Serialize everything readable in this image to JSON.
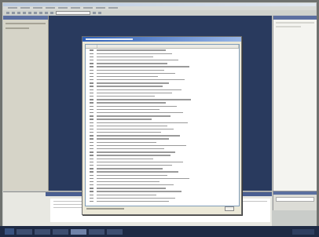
{
  "screen": {
    "description_free": true
  },
  "dialog": {
    "rows": [
      {
        "w": 88
      },
      {
        "w": 96
      },
      {
        "w": 72
      },
      {
        "w": 104
      },
      {
        "w": 90
      },
      {
        "w": 118
      },
      {
        "w": 86
      },
      {
        "w": 100
      },
      {
        "w": 78
      },
      {
        "w": 112
      },
      {
        "w": 92
      },
      {
        "w": 84
      },
      {
        "w": 108
      },
      {
        "w": 96
      },
      {
        "w": 74
      },
      {
        "w": 120
      },
      {
        "w": 88
      },
      {
        "w": 102
      },
      {
        "w": 80
      },
      {
        "w": 110
      },
      {
        "w": 94
      },
      {
        "w": 70
      },
      {
        "w": 116
      },
      {
        "w": 90
      },
      {
        "w": 98
      },
      {
        "w": 82
      },
      {
        "w": 106
      },
      {
        "w": 92
      },
      {
        "w": 76
      },
      {
        "w": 114
      },
      {
        "w": 86
      },
      {
        "w": 100
      },
      {
        "w": 94
      },
      {
        "w": 72
      },
      {
        "w": 110
      },
      {
        "w": 96
      },
      {
        "w": 84
      },
      {
        "w": 104
      },
      {
        "w": 90
      },
      {
        "w": 118
      },
      {
        "w": 80
      },
      {
        "w": 98
      },
      {
        "w": 88
      },
      {
        "w": 108
      },
      {
        "w": 76
      },
      {
        "w": 100
      },
      {
        "w": 92
      }
    ]
  },
  "colors": {
    "workspace": "#293a5e",
    "dialog_title": "#2e5fb7"
  }
}
